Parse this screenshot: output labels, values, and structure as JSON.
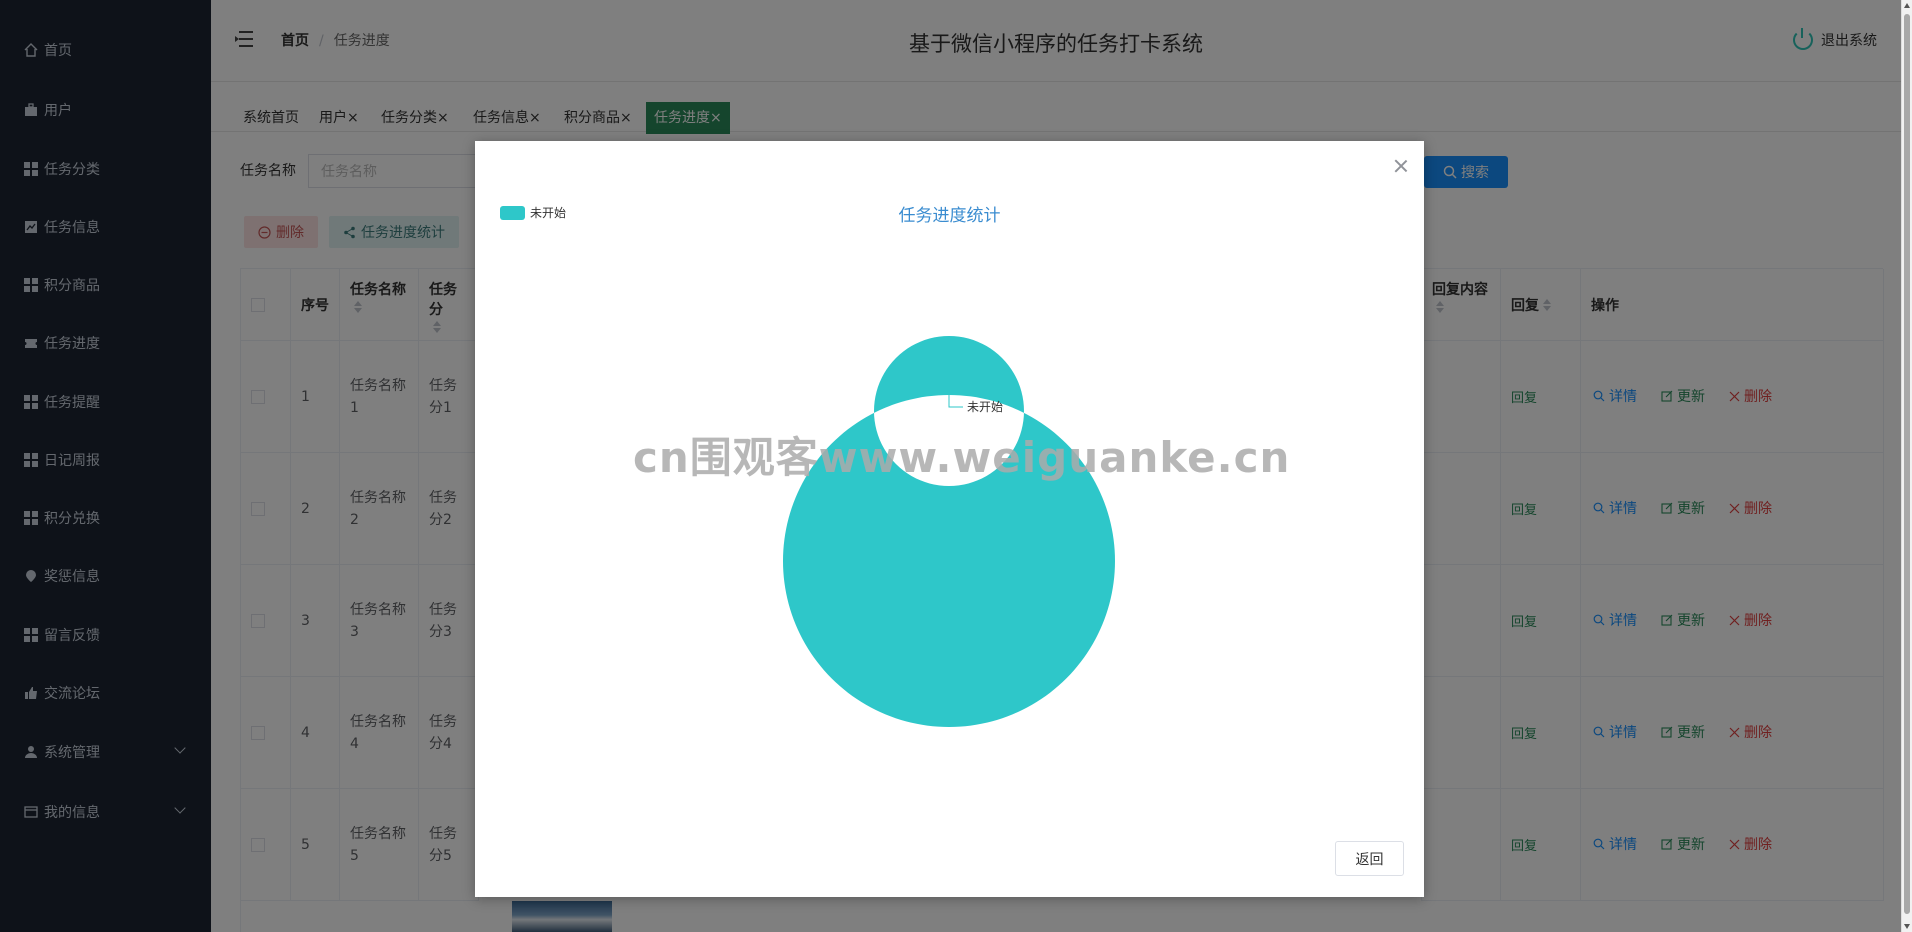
{
  "sidebar": {
    "items": [
      {
        "label": "首页",
        "icon": "home-icon"
      },
      {
        "label": "用户",
        "icon": "briefcase-icon"
      },
      {
        "label": "任务分类",
        "icon": "grid-icon"
      },
      {
        "label": "任务信息",
        "icon": "chart-icon"
      },
      {
        "label": "积分商品",
        "icon": "grid-icon"
      },
      {
        "label": "任务进度",
        "icon": "ticket-icon"
      },
      {
        "label": "任务提醒",
        "icon": "grid-icon"
      },
      {
        "label": "日记周报",
        "icon": "grid-icon"
      },
      {
        "label": "积分兑换",
        "icon": "grid-icon"
      },
      {
        "label": "奖惩信息",
        "icon": "location-icon"
      },
      {
        "label": "留言反馈",
        "icon": "grid-icon"
      },
      {
        "label": "交流论坛",
        "icon": "thumb-icon"
      },
      {
        "label": "系统管理",
        "icon": "user-icon"
      },
      {
        "label": "我的信息",
        "icon": "card-icon"
      }
    ]
  },
  "header": {
    "breadcrumb_home": "首页",
    "breadcrumb_sep": "/",
    "breadcrumb_current": "任务进度",
    "title": "基于微信小程序的任务打卡系统",
    "logout": "退出系统"
  },
  "tabs": [
    {
      "label": "系统首页"
    },
    {
      "label": "用户×"
    },
    {
      "label": "任务分类×"
    },
    {
      "label": "任务信息×"
    },
    {
      "label": "积分商品×"
    },
    {
      "label": "任务进度×"
    }
  ],
  "search": {
    "label": "任务名称",
    "placeholder": "任务名称",
    "button": "搜索"
  },
  "actions": {
    "delete": "删除",
    "stats": "任务进度统计"
  },
  "table": {
    "headers": {
      "index": "序号",
      "task_name": "任务名称",
      "task_cat": "任务分",
      "reply_content": "回复内容",
      "reply": "回复",
      "ops": "操作"
    },
    "rows": [
      {
        "index": "1",
        "name": "任务名称1",
        "cat": "任务分1"
      },
      {
        "index": "2",
        "name": "任务名称2",
        "cat": "任务分2"
      },
      {
        "index": "3",
        "name": "任务名称3",
        "cat": "任务分3"
      },
      {
        "index": "4",
        "name": "任务名称4",
        "cat": "任务分4"
      },
      {
        "index": "5",
        "name": "任务名称5",
        "cat": "任务分5"
      }
    ],
    "reply_link": "回复",
    "op_detail": "详情",
    "op_update": "更新",
    "op_delete": "删除"
  },
  "modal": {
    "chart_title": "任务进度统计",
    "return_button": "返回"
  },
  "chart_data": {
    "type": "pie",
    "title": "任务进度统计",
    "categories": [
      "未开始"
    ],
    "values": [
      1
    ],
    "colors": [
      "#2ec7c9"
    ],
    "donut": true,
    "legend_position": "top-left"
  },
  "watermark": "cn围观客www.weiguanke.cn",
  "colors": {
    "sidebar_bg": "#1c2533",
    "active_tab": "#2a8a5a",
    "primary": "#1890ff",
    "chart_slice": "#2ec7c9"
  }
}
